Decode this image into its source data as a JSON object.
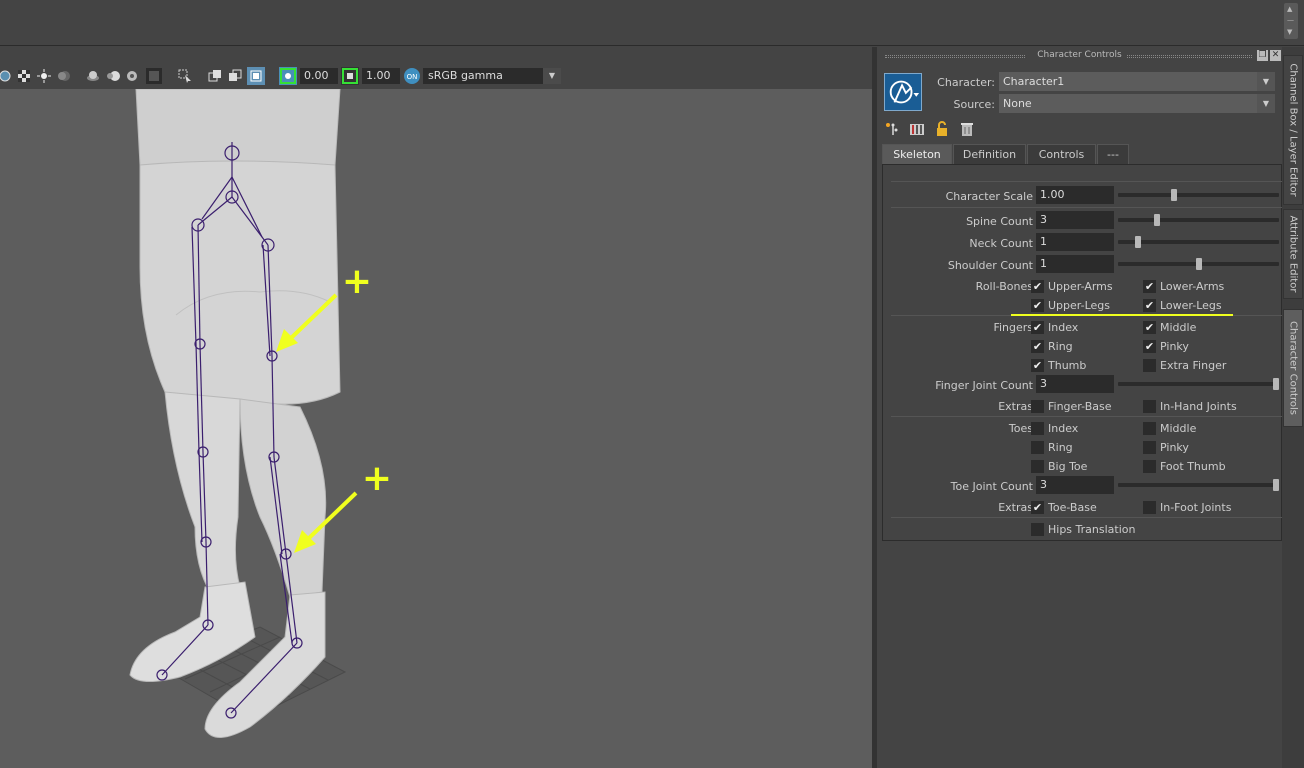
{
  "viewport": {
    "toolbar": {
      "exposure_value": "0.00",
      "gamma_value": "1.00",
      "color_space": "sRGB gamma"
    },
    "annotations": {
      "plus_1": "+",
      "plus_2": "+"
    },
    "accent_color": "#f0ff1e"
  },
  "panel": {
    "title": "Character Controls",
    "character_label": "Character:",
    "character_value": "Character1",
    "source_label": "Source:",
    "source_value": "None",
    "tabs": [
      {
        "label": "Skeleton",
        "active": true
      },
      {
        "label": "Definition",
        "active": false
      },
      {
        "label": "Controls",
        "active": false
      },
      {
        "label": "---",
        "active": false
      }
    ],
    "character_scale": {
      "label": "Character Scale",
      "value": "1.00",
      "slider": 0.33
    },
    "spine_count": {
      "label": "Spine Count",
      "value": "3",
      "slider": 0.24
    },
    "neck_count": {
      "label": "Neck Count",
      "value": "1",
      "slider": 0.12
    },
    "shoulder_count": {
      "label": "Shoulder Count",
      "value": "1",
      "slider": 0.5
    },
    "roll_bones": {
      "label": "Roll-Bones",
      "upper_arms": {
        "label": "Upper-Arms",
        "checked": true
      },
      "lower_arms": {
        "label": "Lower-Arms",
        "checked": true
      },
      "upper_legs": {
        "label": "Upper-Legs",
        "checked": true
      },
      "lower_legs": {
        "label": "Lower-Legs",
        "checked": true
      }
    },
    "fingers": {
      "label": "Fingers",
      "index": {
        "label": "Index",
        "checked": true
      },
      "middle": {
        "label": "Middle",
        "checked": true
      },
      "ring": {
        "label": "Ring",
        "checked": true
      },
      "pinky": {
        "label": "Pinky",
        "checked": true
      },
      "thumb": {
        "label": "Thumb",
        "checked": true
      },
      "extra_finger": {
        "label": "Extra Finger",
        "checked": false
      }
    },
    "finger_joint_count": {
      "label": "Finger Joint Count",
      "value": "3",
      "slider": 1.0
    },
    "finger_extras": {
      "label": "Extras",
      "finger_base": {
        "label": "Finger-Base",
        "checked": false
      },
      "in_hand_joints": {
        "label": "In-Hand Joints",
        "checked": false
      }
    },
    "toes": {
      "label": "Toes",
      "index": {
        "label": "Index",
        "checked": false
      },
      "middle": {
        "label": "Middle",
        "checked": false
      },
      "ring": {
        "label": "Ring",
        "checked": false
      },
      "pinky": {
        "label": "Pinky",
        "checked": false
      },
      "big_toe": {
        "label": "Big Toe",
        "checked": false
      },
      "foot_thumb": {
        "label": "Foot Thumb",
        "checked": false
      }
    },
    "toe_joint_count": {
      "label": "Toe Joint Count",
      "value": "3",
      "slider": 1.0
    },
    "toe_extras": {
      "label": "Extras",
      "toe_base": {
        "label": "Toe-Base",
        "checked": true
      },
      "in_foot_joints": {
        "label": "In-Foot Joints",
        "checked": false
      }
    },
    "hips_translation": {
      "label": "Hips Translation",
      "checked": false
    }
  },
  "side_tabs": [
    {
      "label": "Channel Box / Layer Editor",
      "active": false
    },
    {
      "label": "Attribute Editor",
      "active": false
    },
    {
      "label": "Character Controls",
      "active": true
    }
  ]
}
